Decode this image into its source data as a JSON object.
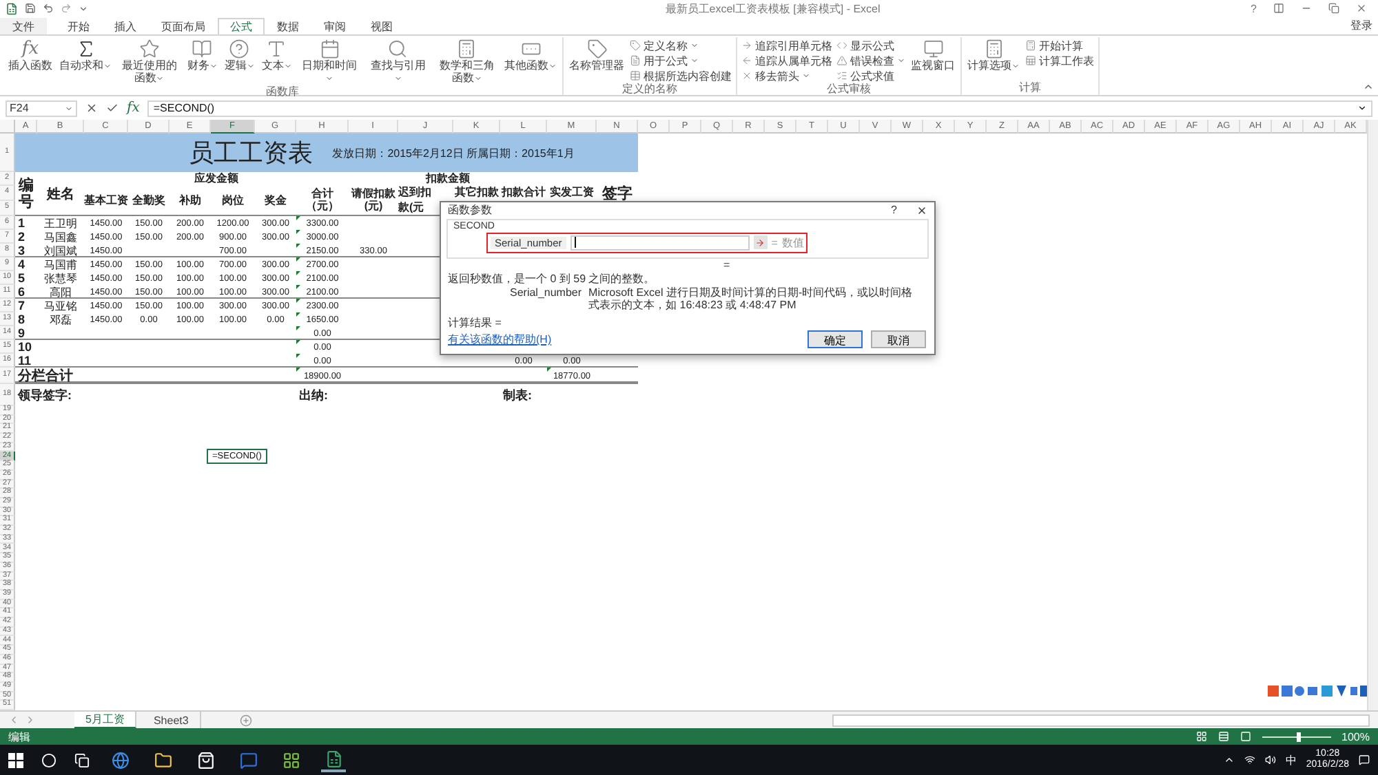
{
  "window": {
    "title": "最新员工excel工资表模板 [兼容模式] - Excel",
    "help": "?",
    "sign_in": "登录"
  },
  "tabs": [
    {
      "label": "文件",
      "selected": false
    },
    {
      "label": "开始",
      "selected": false
    },
    {
      "label": "插入",
      "selected": false
    },
    {
      "label": "页面布局",
      "selected": false
    },
    {
      "label": "公式",
      "selected": true
    },
    {
      "label": "数据",
      "selected": false
    },
    {
      "label": "审阅",
      "selected": false
    },
    {
      "label": "视图",
      "selected": false
    }
  ],
  "ribbon": {
    "groups": [
      {
        "label": "函数库",
        "items": [
          {
            "kind": "large",
            "label": "插入函数",
            "glyph": "fx",
            "menu": false
          },
          {
            "kind": "large",
            "label": "自动求和",
            "menu": true
          },
          {
            "kind": "large",
            "label": "最近使用的函数",
            "menu": true
          },
          {
            "kind": "large",
            "label": "财务",
            "menu": true
          },
          {
            "kind": "large",
            "label": "逻辑",
            "menu": true
          },
          {
            "kind": "large",
            "label": "文本",
            "menu": true
          },
          {
            "kind": "large",
            "label": "日期和时间",
            "menu": true
          },
          {
            "kind": "large",
            "label": "查找与引用",
            "menu": true
          },
          {
            "kind": "large",
            "label": "数学和三角函数",
            "menu": true
          },
          {
            "kind": "large",
            "label": "其他函数",
            "menu": true
          }
        ]
      },
      {
        "label": "定义的名称",
        "items": [
          {
            "kind": "large",
            "label": "名称管理器",
            "menu": false
          },
          {
            "kind": "small",
            "label": "定义名称",
            "menu": true
          },
          {
            "kind": "small",
            "label": "用于公式",
            "menu": true
          },
          {
            "kind": "small",
            "label": "根据所选内容创建",
            "menu": false
          }
        ]
      },
      {
        "label": "公式审核",
        "items": [
          {
            "kind": "small",
            "label": "追踪引用单元格",
            "menu": false
          },
          {
            "kind": "small",
            "label": "追踪从属单元格",
            "menu": false
          },
          {
            "kind": "small",
            "label": "移去箭头",
            "menu": true
          },
          {
            "kind": "small",
            "label": "显示公式",
            "menu": false
          },
          {
            "kind": "small",
            "label": "错误检查",
            "menu": true
          },
          {
            "kind": "small",
            "label": "公式求值",
            "menu": false
          },
          {
            "kind": "large",
            "label": "监视窗口",
            "menu": false
          }
        ]
      },
      {
        "label": "计算",
        "items": [
          {
            "kind": "large",
            "label": "计算选项",
            "menu": true
          },
          {
            "kind": "small",
            "label": "开始计算",
            "menu": false
          },
          {
            "kind": "small",
            "label": "计算工作表",
            "menu": false
          }
        ]
      }
    ]
  },
  "formula_bar": {
    "name_box": "F24",
    "fx": "fx",
    "formula": "=SECOND()"
  },
  "columns": [
    {
      "label": "A",
      "selected": false
    },
    {
      "label": "B",
      "selected": false
    },
    {
      "label": "C",
      "selected": false
    },
    {
      "label": "D",
      "selected": false
    },
    {
      "label": "E",
      "selected": false
    },
    {
      "label": "F",
      "selected": true
    },
    {
      "label": "G",
      "selected": false
    },
    {
      "label": "H",
      "selected": false
    },
    {
      "label": "I",
      "selected": false
    },
    {
      "label": "J",
      "selected": false
    },
    {
      "label": "K",
      "selected": false
    },
    {
      "label": "L",
      "selected": false
    },
    {
      "label": "M",
      "selected": false
    },
    {
      "label": "N",
      "selected": false
    },
    {
      "label": "O",
      "selected": false
    },
    {
      "label": "P",
      "selected": false
    },
    {
      "label": "Q",
      "selected": false
    },
    {
      "label": "R",
      "selected": false
    },
    {
      "label": "S",
      "selected": false
    },
    {
      "label": "T",
      "selected": false
    },
    {
      "label": "U",
      "selected": false
    },
    {
      "label": "V",
      "selected": false
    },
    {
      "label": "W",
      "selected": false
    },
    {
      "label": "X",
      "selected": false
    },
    {
      "label": "Y",
      "selected": false
    },
    {
      "label": "Z",
      "selected": false
    },
    {
      "label": "AA",
      "selected": false
    },
    {
      "label": "AB",
      "selected": false
    },
    {
      "label": "AC",
      "selected": false
    },
    {
      "label": "AD",
      "selected": false
    },
    {
      "label": "AE",
      "selected": false
    },
    {
      "label": "AF",
      "selected": false
    },
    {
      "label": "AG",
      "selected": false
    },
    {
      "label": "AH",
      "selected": false
    },
    {
      "label": "AI",
      "selected": false
    },
    {
      "label": "AJ",
      "selected": false
    },
    {
      "label": "AK",
      "selected": false
    }
  ],
  "rows": [
    {
      "label": "1",
      "selected": false
    },
    {
      "label": "2",
      "selected": false
    },
    {
      "label": "4",
      "selected": false
    },
    {
      "label": "5",
      "selected": false
    },
    {
      "label": "6",
      "selected": false
    },
    {
      "label": "7",
      "selected": false
    },
    {
      "label": "8",
      "selected": false
    },
    {
      "label": "9",
      "selected": false
    },
    {
      "label": "10",
      "selected": false
    },
    {
      "label": "11",
      "selected": false
    },
    {
      "label": "12",
      "selected": false
    },
    {
      "label": "13",
      "selected": false
    },
    {
      "label": "14",
      "selected": false
    },
    {
      "label": "15",
      "selected": false
    },
    {
      "label": "16",
      "selected": false
    },
    {
      "label": "17",
      "selected": false
    },
    {
      "label": "18",
      "selected": false
    },
    {
      "label": "19",
      "selected": false
    },
    {
      "label": "20",
      "selected": false
    },
    {
      "label": "21",
      "selected": false
    },
    {
      "label": "22",
      "selected": false
    },
    {
      "label": "23",
      "selected": false
    },
    {
      "label": "24",
      "selected": true
    },
    {
      "label": "25",
      "selected": false
    },
    {
      "label": "26",
      "selected": false
    },
    {
      "label": "27",
      "selected": false
    },
    {
      "label": "28",
      "selected": false
    },
    {
      "label": "29",
      "selected": false
    },
    {
      "label": "30",
      "selected": false
    },
    {
      "label": "31",
      "selected": false
    },
    {
      "label": "32",
      "selected": false
    },
    {
      "label": "33",
      "selected": false
    },
    {
      "label": "34",
      "selected": false
    },
    {
      "label": "35",
      "selected": false
    },
    {
      "label": "36",
      "selected": false
    },
    {
      "label": "37",
      "selected": false
    },
    {
      "label": "38",
      "selected": false
    },
    {
      "label": "39",
      "selected": false
    },
    {
      "label": "40",
      "selected": false
    },
    {
      "label": "41",
      "selected": false
    },
    {
      "label": "42",
      "selected": false
    },
    {
      "label": "43",
      "selected": false
    },
    {
      "label": "44",
      "selected": false
    },
    {
      "label": "45",
      "selected": false
    },
    {
      "label": "46",
      "selected": false
    },
    {
      "label": "47",
      "selected": false
    },
    {
      "label": "48",
      "selected": false
    },
    {
      "label": "49",
      "selected": false
    },
    {
      "label": "50",
      "selected": false
    },
    {
      "label": "51",
      "selected": false
    }
  ],
  "table": {
    "title": "员工工资表",
    "issue_info": "发放日期：2015年2月12日 所属日期：2015年1月",
    "header": {
      "no": "编号",
      "name": "姓名",
      "payable": "应发金额",
      "deductions": "扣款金额",
      "base": "基本工资",
      "attendance": "全勤奖",
      "allowance": "补助",
      "post": "岗位",
      "bonus": "奖金",
      "total": "合计（元）",
      "leave": "请假扣款(元)",
      "late_1": "迟到扣",
      "late_2": "款(元",
      "other": "其它扣款",
      "deduct_total": "扣款合计",
      "net": "实发工资",
      "sign": "签字"
    },
    "rows": [
      {
        "cells": {
          "A": "1",
          "B": "王卫明",
          "C": "1450.00",
          "D": "150.00",
          "E": "200.00",
          "F": "1200.00",
          "G": "300.00",
          "H": "3300.00"
        },
        "marked": true,
        "group_end": false
      },
      {
        "cells": {
          "A": "2",
          "B": "马国鑫",
          "C": "1450.00",
          "D": "150.00",
          "E": "200.00",
          "F": "900.00",
          "G": "300.00",
          "H": "3000.00"
        },
        "marked": true,
        "group_end": false
      },
      {
        "cells": {
          "A": "3",
          "B": "刘国斌",
          "C": "1450.00",
          "F": "700.00",
          "H": "2150.00",
          "I": "330.00"
        },
        "marked": true,
        "group_end": true
      },
      {
        "cells": {
          "A": "4",
          "B": "马国甫",
          "C": "1450.00",
          "D": "150.00",
          "E": "100.00",
          "F": "700.00",
          "G": "300.00",
          "H": "2700.00"
        },
        "marked": true,
        "group_end": false
      },
      {
        "cells": {
          "A": "5",
          "B": "张慧琴",
          "C": "1450.00",
          "D": "150.00",
          "E": "100.00",
          "F": "100.00",
          "G": "300.00",
          "H": "2100.00"
        },
        "marked": true,
        "group_end": false
      },
      {
        "cells": {
          "A": "6",
          "B": "高阳",
          "C": "1450.00",
          "D": "150.00",
          "E": "100.00",
          "F": "100.00",
          "G": "300.00",
          "H": "2100.00"
        },
        "marked": true,
        "group_end": true
      },
      {
        "cells": {
          "A": "7",
          "B": "马亚铭",
          "C": "1450.00",
          "D": "150.00",
          "E": "100.00",
          "F": "300.00",
          "G": "300.00",
          "H": "2300.00"
        },
        "marked": true,
        "group_end": false
      },
      {
        "cells": {
          "A": "8",
          "B": "邓磊",
          "C": "1450.00",
          "D": "0.00",
          "E": "100.00",
          "F": "100.00",
          "G": "0.00",
          "H": "1650.00"
        },
        "marked": true,
        "group_end": false
      },
      {
        "cells": {
          "A": "9",
          "H": "0.00"
        },
        "marked": true,
        "group_end": true
      },
      {
        "cells": {
          "A": "10",
          "H": "0.00"
        },
        "marked": true,
        "group_end": false
      },
      {
        "cells": {
          "A": "11",
          "H": "0.00",
          "L": "0.00",
          "M": "0.00"
        },
        "marked": true,
        "group_end": true
      }
    ],
    "summary": {
      "label": "分栏合计",
      "total": "18900.00",
      "net": "18770.00",
      "marked": true
    },
    "footer": {
      "leader": "领导签字:",
      "cashier": "出纳:",
      "preparer": "制表:"
    }
  },
  "editing_cell": {
    "text": "=SECOND()"
  },
  "dialog": {
    "title": "函数参数",
    "help": "?",
    "function": "SECOND",
    "highlighted": true,
    "argument": {
      "label": "Serial_number",
      "equals": "=",
      "preview": "数值"
    },
    "result_preview": "=",
    "description": "返回秒数值，是一个 0 到 59 之间的整数。",
    "arg_help": {
      "label": "Serial_number",
      "text": "Microsoft Excel 进行日期及时间计算的日期-时间代码，或以时间格式表示的文本，如 16:48:23 或 4:48:47 PM"
    },
    "result": "计算结果 =",
    "help_link": "有关该函数的帮助(H)",
    "buttons": [
      {
        "label": "确定",
        "default": true
      },
      {
        "label": "取消",
        "default": false
      }
    ]
  },
  "sheet_tabs": [
    {
      "label": "5月工资",
      "selected": true
    },
    {
      "label": "Sheet3",
      "selected": false
    }
  ],
  "status_bar": {
    "mode": "编辑",
    "zoom": "100%",
    "level": 0.5
  },
  "taskbar": {
    "ime": "中",
    "time": "10:28",
    "date": "2016/2/28"
  }
}
